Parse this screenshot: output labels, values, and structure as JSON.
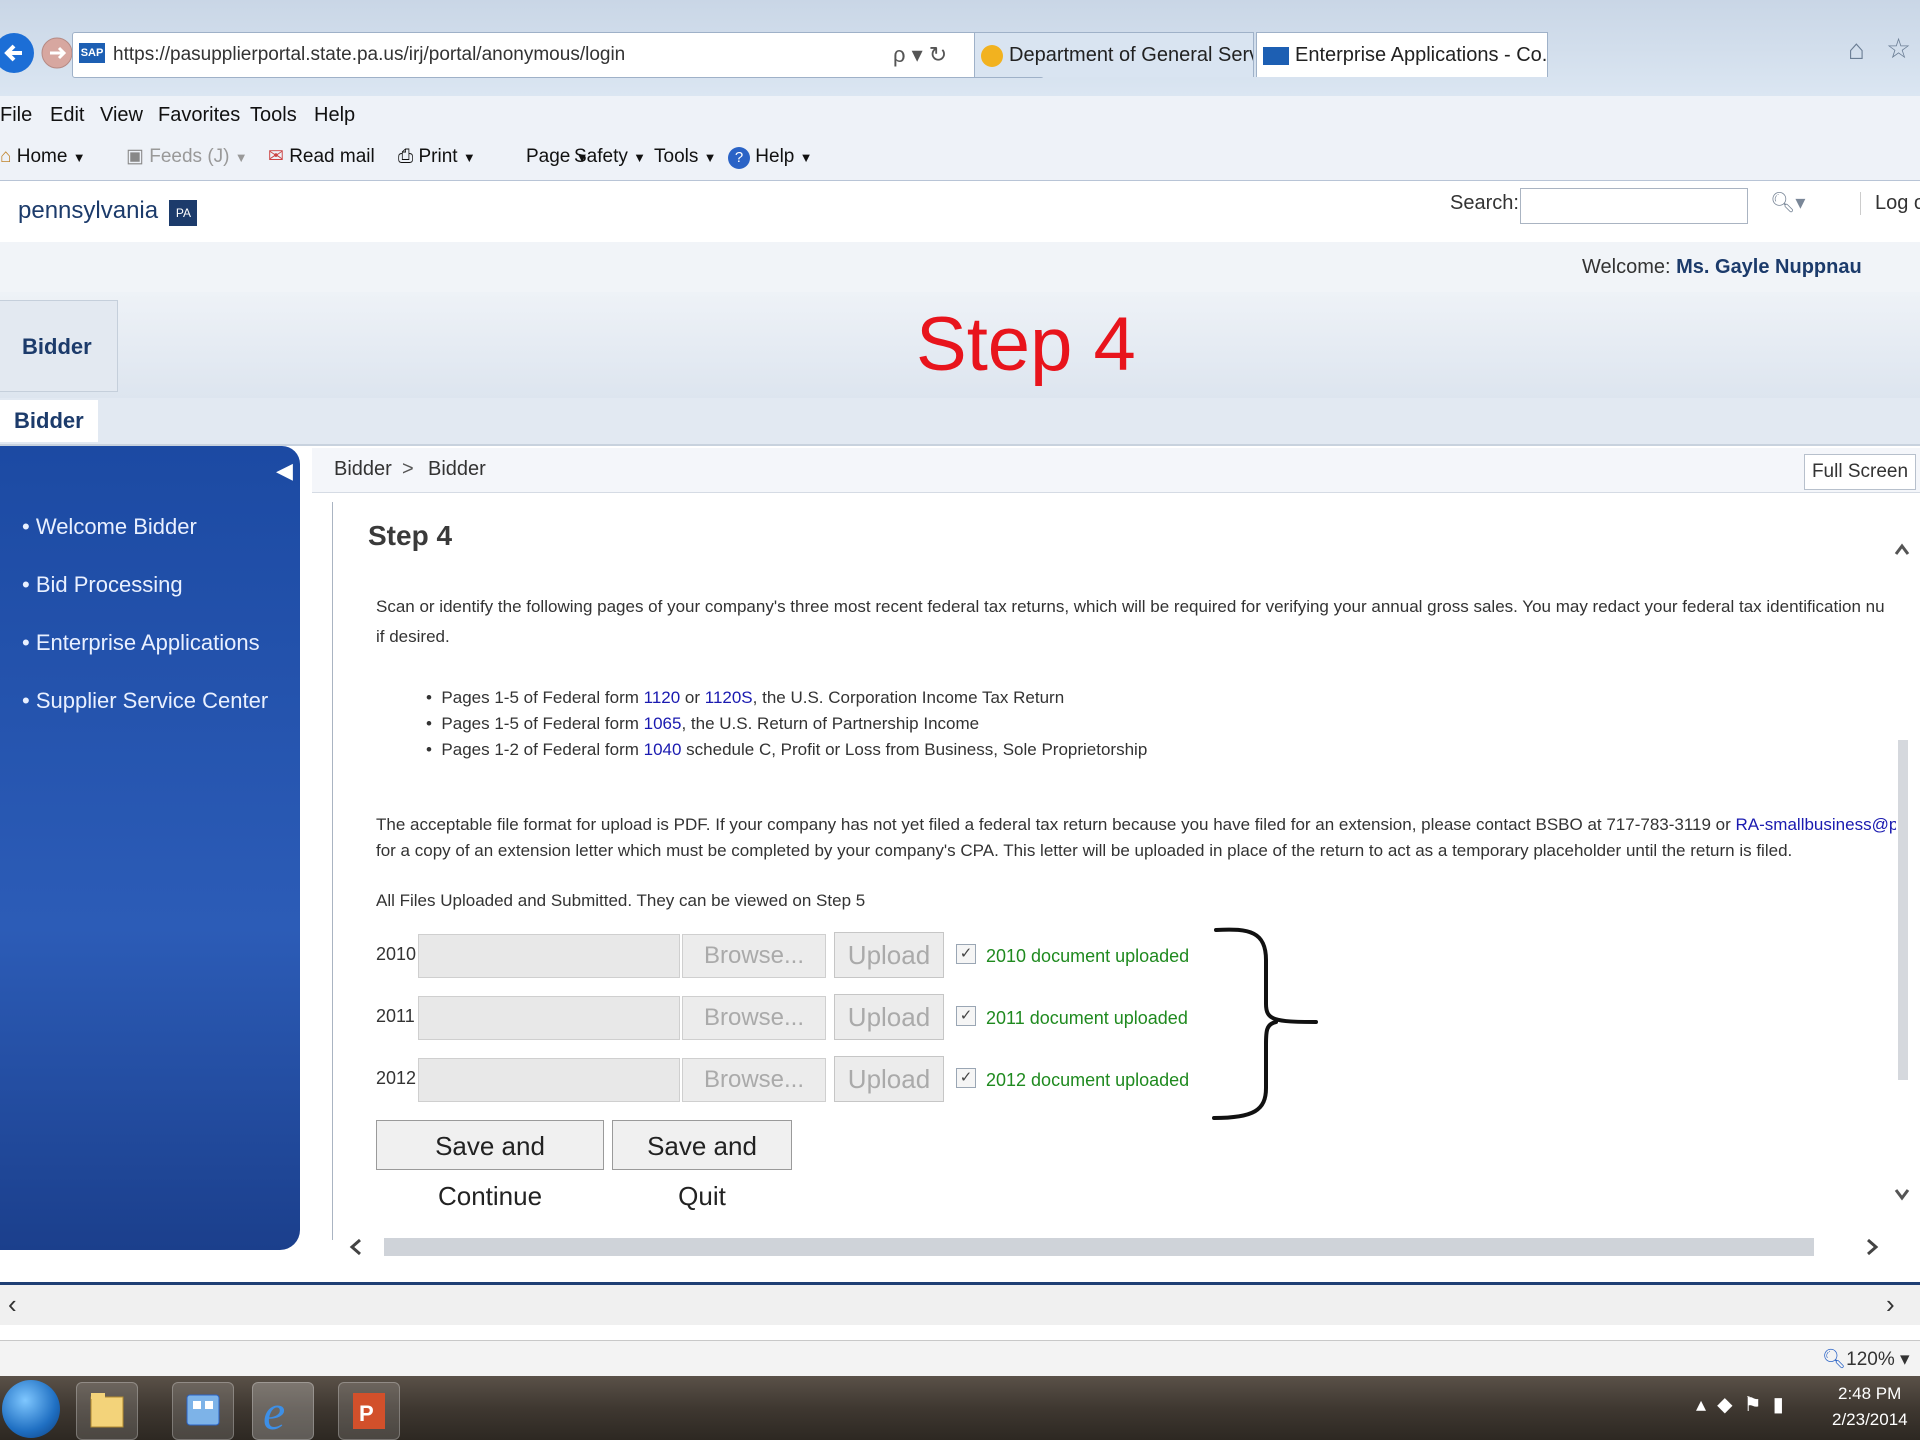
{
  "browser": {
    "url": "https://pasupplierportal.state.pa.us/irj/portal/anonymous/login",
    "url_host_bold": "state.pa.us",
    "search_glyph": "ρ ▾ ↻",
    "tabs": [
      {
        "title": "Department of General Services",
        "active": false
      },
      {
        "title": "Enterprise Applications - Co...",
        "active": true
      }
    ],
    "menu": [
      "File",
      "Edit",
      "View",
      "Favorites",
      "Tools",
      "Help"
    ],
    "command_bar": {
      "home": "Home",
      "feeds": "Feeds (J)",
      "read_mail": "Read mail",
      "print": "Print",
      "page": "Page",
      "safety": "Safety",
      "tools": "Tools",
      "help": "Help"
    }
  },
  "portal": {
    "logo_text": "pennsylvania",
    "logo_badge": "PA",
    "search_label": "Search:",
    "search_value": "",
    "log_off": "Log off",
    "welcome_label": "Welcome:",
    "welcome_user": "Ms. Gayle Nuppnau",
    "top_tab": "Bidder",
    "sub_tab": "Bidder",
    "overlay_title": "Step 4",
    "breadcrumb": {
      "first": "Bidder",
      "sep": ">",
      "second": "Bidder"
    },
    "full_screen": "Full Screen",
    "nav": [
      "Welcome Bidder",
      "Bid Processing",
      "Enterprise Applications",
      "Supplier Service Center"
    ]
  },
  "step": {
    "heading": "Step 4",
    "intro_line1": "Scan or identify the following pages of your company's three most recent federal tax returns, which will be required for verifying your annual gross sales. You may redact your federal tax identification nu",
    "intro_line2": "if desired.",
    "bullets": [
      {
        "pre": "Pages 1-5 of Federal form ",
        "link1": "1120",
        "mid": " or ",
        "link2": "1120S",
        "post": ", the U.S. Corporation Income Tax Return"
      },
      {
        "pre": "Pages 1-5 of Federal form ",
        "link1": "1065",
        "mid": "",
        "link2": "",
        "post": ", the U.S. Return of Partnership Income"
      },
      {
        "pre": "Pages 1-2 of Federal form ",
        "link1": "1040",
        "mid": "",
        "link2": "",
        "post": " schedule C, Profit or Loss from Business, Sole Proprietorship"
      }
    ],
    "format_line1_pre": "The acceptable file format for upload is PDF. If your company has not yet filed a federal tax return because you have filed for an extension, please contact BSBO at 717-783-3119 or ",
    "format_line1_link": "RA-smallbusiness@pa.",
    "format_line2": "for a copy of an extension letter which must be completed by your company's CPA. This letter will be uploaded in place of the return to act as a temporary placeholder until the return is filed.",
    "all_files_msg": "All Files Uploaded and Submitted. They can be viewed on Step 5",
    "uploads": [
      {
        "year": "2010",
        "browse": "Browse...",
        "upload": "Upload",
        "status": "2010 document uploaded"
      },
      {
        "year": "2011",
        "browse": "Browse...",
        "upload": "Upload",
        "status": "2011 document uploaded"
      },
      {
        "year": "2012",
        "browse": "Browse...",
        "upload": "Upload",
        "status": "2012 document uploaded"
      }
    ],
    "save_continue": "Save and Continue",
    "save_quit": "Save and Quit"
  },
  "status": {
    "zoom": "120%"
  },
  "taskbar": {
    "time": "2:48 PM",
    "date": "2/23/2014"
  },
  "colors": {
    "overlay_red": "#e8141c",
    "nav_blue": "#2452a9",
    "uploaded_green": "#1f8a1f",
    "link_blue": "#1a1ab0"
  }
}
